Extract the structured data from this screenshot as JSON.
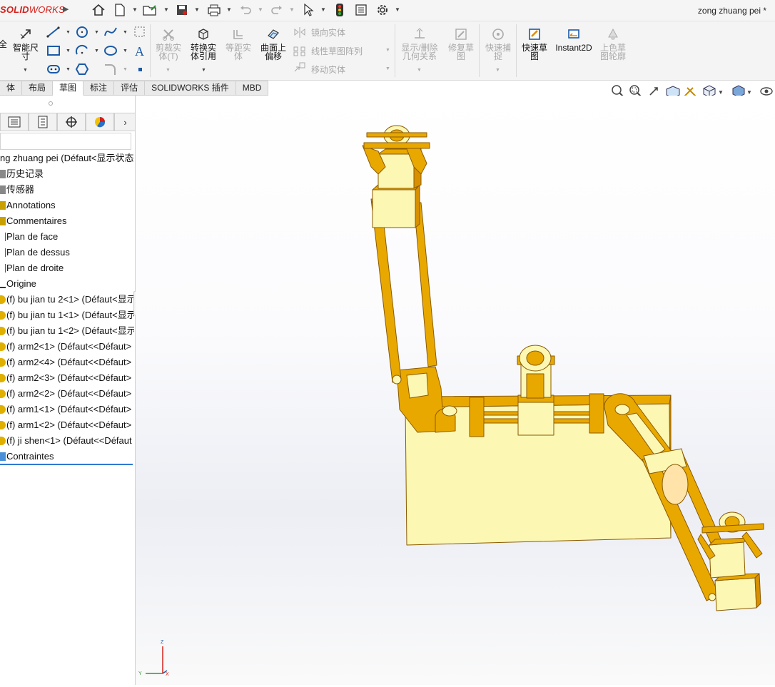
{
  "app": {
    "logo_prefix": "SOLID",
    "logo_suffix": "WORKS",
    "document_title": "zong zhuang pei *"
  },
  "colors": {
    "brand": "#d6201b",
    "part_face": "#fdf7b4",
    "part_side": "#e9a800",
    "part_edge": "#8a5a00",
    "selection_blue": "#2e7bd0"
  },
  "titlebar_icons": [
    "home-icon",
    "new-document-icon",
    "open-icon",
    "save-icon",
    "print-icon",
    "undo-icon",
    "redo-icon",
    "select-icon",
    "rebuild-icon",
    "file-properties-icon",
    "options-icon"
  ],
  "command_manager": {
    "smart_dimension_partial": "全",
    "smart_dimension": "智能尺寸",
    "trim": "剪裁实体(T)",
    "convert": "转换实体引用",
    "offset": "等距实体",
    "surface_offset": "曲面上偏移",
    "mirror": "镜向实体",
    "linear_pattern": "线性草图阵列",
    "move": "移动实体",
    "relations": "显示/删除几何关系",
    "repair": "修复草图",
    "quick_snap": "快速捕捉",
    "rapid_sketch": "快速草图",
    "instant2d": "Instant2D",
    "shaded_contours": "上色草图轮廓"
  },
  "tabs": [
    "体",
    "布局",
    "草图",
    "标注",
    "评估",
    "SOLIDWORKS 插件",
    "MBD"
  ],
  "active_tab": "草图",
  "feature_tree": {
    "root": "ng zhuang pei  (Défaut<显示状态",
    "items": [
      "历史记录",
      "传感器",
      "Annotations",
      "Commentaires",
      "Plan de face",
      "Plan de dessus",
      "Plan de droite",
      "Origine",
      "(f) bu jian tu 2<1> (Défaut<显示",
      "(f) bu jian tu 1<1> (Défaut<显示",
      "(f) bu jian tu 1<2> (Défaut<显示",
      "(f) arm2<1> (Défaut<<Défaut>",
      "(f) arm2<4> (Défaut<<Défaut>",
      "(f) arm2<3> (Défaut<<Défaut>",
      "(f) arm2<2> (Défaut<<Défaut>",
      "(f) arm1<1> (Défaut<<Défaut>",
      "(f) arm1<2> (Défaut<<Défaut>",
      "(f) ji shen<1> (Défaut<<Défaut",
      "Contraintes"
    ]
  },
  "panel_tabs": [
    "feature-manager-icon",
    "property-manager-icon",
    "configuration-manager-icon",
    "dimxpert-icon",
    "display-manager-icon"
  ],
  "triad": {
    "x": "X",
    "y": "Y",
    "z": "Z"
  }
}
